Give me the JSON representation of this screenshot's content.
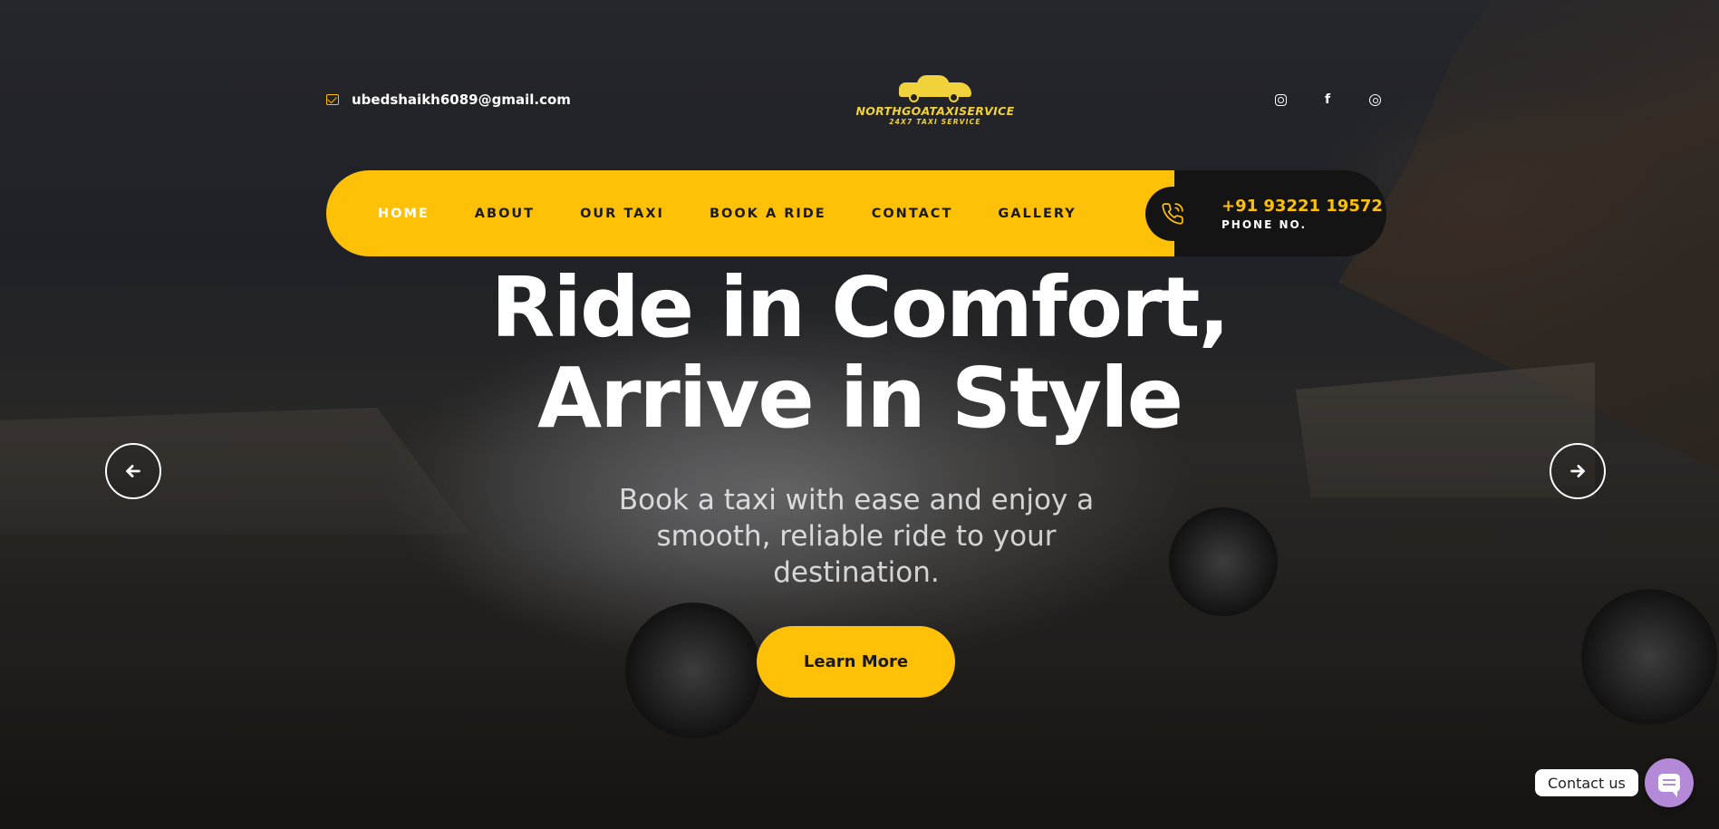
{
  "topbar": {
    "email": "ubedshaikh6089@gmail.com",
    "email_icon": "envelope-icon",
    "logo": {
      "name": "NORTHGOATAXISERVICE",
      "tagline": "24X7 TAXI SERVICE"
    },
    "socials": [
      {
        "name": "instagram",
        "icon": "instagram-icon"
      },
      {
        "name": "facebook",
        "icon": "facebook-icon",
        "glyph": "f"
      },
      {
        "name": "threads",
        "icon": "threads-icon"
      }
    ]
  },
  "nav": {
    "items": [
      {
        "label": "HOME",
        "active": true
      },
      {
        "label": "ABOUT",
        "active": false
      },
      {
        "label": "OUR TAXI",
        "active": false
      },
      {
        "label": "BOOK A RIDE",
        "active": false
      },
      {
        "label": "CONTACT",
        "active": false
      },
      {
        "label": "GALLERY",
        "active": false
      }
    ],
    "phone": {
      "number": "+91 93221 19572",
      "label": "PHONE NO.",
      "icon": "phone-icon"
    }
  },
  "hero": {
    "headline_line1": "Ride in Comfort,",
    "headline_line2": "Arrive in Style",
    "subtext": "Book a taxi with ease and enjoy a smooth, reliable ride to your destination.",
    "cta_label": "Learn More",
    "prev_icon": "arrow-left-icon",
    "next_icon": "arrow-right-icon"
  },
  "contact_widget": {
    "label": "Contact us",
    "icon": "chat-icon"
  },
  "colors": {
    "accent": "#ffc107",
    "dark": "#141414",
    "widget": "#b389d8",
    "logo": "#f2d23a"
  }
}
